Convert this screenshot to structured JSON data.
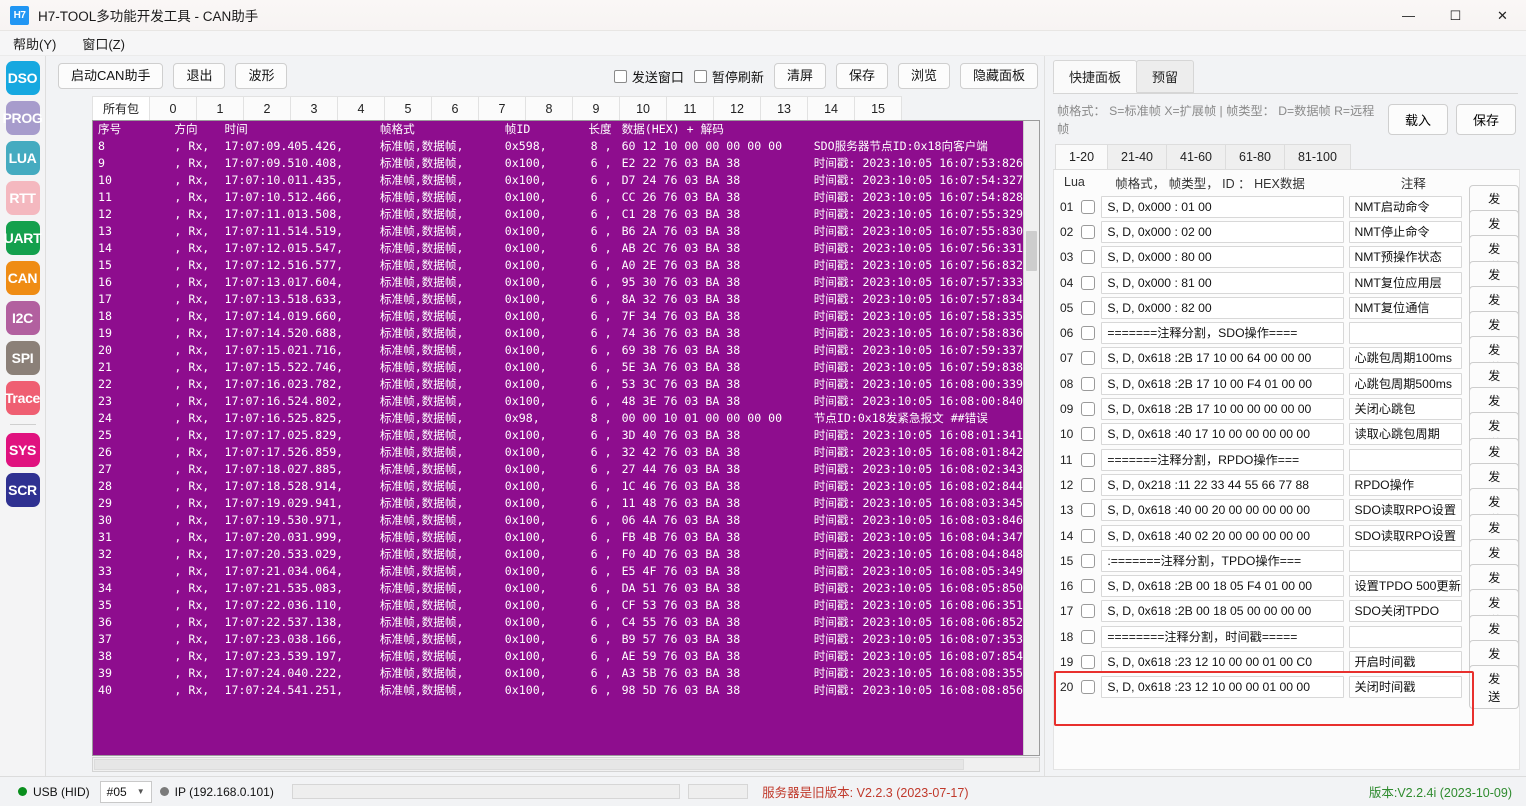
{
  "window": {
    "logo_text": "H7",
    "title": "H7-TOOL多功能开发工具 - CAN助手",
    "minimize": "—",
    "maximize": "☐",
    "close": "✕"
  },
  "menu": {
    "items": [
      {
        "label": "帮助(Y)"
      },
      {
        "label": "窗口(Z)"
      }
    ]
  },
  "rail": {
    "items": [
      {
        "label": "DSO",
        "color": "#16a8e0"
      },
      {
        "label": "PROG",
        "color": "#a79ccc"
      },
      {
        "label": "LUA",
        "color": "#45abc0"
      },
      {
        "label": "RTT",
        "color": "#f4b8bf"
      },
      {
        "label": "UART",
        "color": "#14a04d"
      },
      {
        "label": "CAN",
        "color": "#ef8c14"
      },
      {
        "label": "I2C",
        "color": "#b2609f"
      },
      {
        "label": "SPI",
        "color": "#8b8078"
      },
      {
        "label": "Trace",
        "color": "#ef5f72"
      },
      {
        "label": "SYS",
        "color": "#e0127f"
      },
      {
        "label": "SCR",
        "color": "#2f3191"
      }
    ],
    "separator_after_index": 8
  },
  "toolbar": {
    "start_button": "启动CAN助手",
    "exit_button": "退出",
    "wave_button": "波形",
    "send_window_checkbox": "发送窗口",
    "pause_refresh_checkbox": "暂停刷新",
    "clear_button": "清屏",
    "save_button": "保存",
    "browse_button": "浏览",
    "hide_panel_button": "隐藏面板"
  },
  "packet_tabs": {
    "active_index": 0,
    "items": [
      "所有包",
      "0",
      "1",
      "2",
      "3",
      "4",
      "5",
      "6",
      "7",
      "8",
      "9",
      "10",
      "11",
      "12",
      "13",
      "14",
      "15"
    ]
  },
  "log": {
    "headers": {
      "seq": "序号",
      "dir": "方向",
      "time": "时间",
      "format": "帧格式",
      "id": "帧ID",
      "length": "长度",
      "data": "数据(HEX) + 解码"
    },
    "rows": [
      {
        "seq": "8",
        "dir": ", Rx,",
        "time": "17:07:09.405.426,",
        "fmt": "标准帧,数据帧,",
        "id": "0x598,",
        "len": "8  ,",
        "data": "60 12 10 00 00 00 00 00",
        "dec": "SDO服务器节点ID:0x18向客户端"
      },
      {
        "seq": "9",
        "dir": ", Rx,",
        "time": "17:07:09.510.408,",
        "fmt": "标准帧,数据帧,",
        "id": "0x100,",
        "len": "6  ,",
        "data": "E2 22 76 03 BA 38",
        "dec": "时间戳: 2023:10:05 16:07:53:826"
      },
      {
        "seq": "10",
        "dir": ", Rx,",
        "time": "17:07:10.011.435,",
        "fmt": "标准帧,数据帧,",
        "id": "0x100,",
        "len": "6  ,",
        "data": "D7 24 76 03 BA 38",
        "dec": "时间戳: 2023:10:05 16:07:54:327"
      },
      {
        "seq": "11",
        "dir": ", Rx,",
        "time": "17:07:10.512.466,",
        "fmt": "标准帧,数据帧,",
        "id": "0x100,",
        "len": "6  ,",
        "data": "CC 26 76 03 BA 38",
        "dec": "时间戳: 2023:10:05 16:07:54:828"
      },
      {
        "seq": "12",
        "dir": ", Rx,",
        "time": "17:07:11.013.508,",
        "fmt": "标准帧,数据帧,",
        "id": "0x100,",
        "len": "6  ,",
        "data": "C1 28 76 03 BA 38",
        "dec": "时间戳: 2023:10:05 16:07:55:329"
      },
      {
        "seq": "13",
        "dir": ", Rx,",
        "time": "17:07:11.514.519,",
        "fmt": "标准帧,数据帧,",
        "id": "0x100,",
        "len": "6  ,",
        "data": "B6 2A 76 03 BA 38",
        "dec": "时间戳: 2023:10:05 16:07:55:830"
      },
      {
        "seq": "14",
        "dir": ", Rx,",
        "time": "17:07:12.015.547,",
        "fmt": "标准帧,数据帧,",
        "id": "0x100,",
        "len": "6  ,",
        "data": "AB 2C 76 03 BA 38",
        "dec": "时间戳: 2023:10:05 16:07:56:331"
      },
      {
        "seq": "15",
        "dir": ", Rx,",
        "time": "17:07:12.516.577,",
        "fmt": "标准帧,数据帧,",
        "id": "0x100,",
        "len": "6  ,",
        "data": "A0 2E 76 03 BA 38",
        "dec": "时间戳: 2023:10:05 16:07:56:832"
      },
      {
        "seq": "16",
        "dir": ", Rx,",
        "time": "17:07:13.017.604,",
        "fmt": "标准帧,数据帧,",
        "id": "0x100,",
        "len": "6  ,",
        "data": "95 30 76 03 BA 38",
        "dec": "时间戳: 2023:10:05 16:07:57:333"
      },
      {
        "seq": "17",
        "dir": ", Rx,",
        "time": "17:07:13.518.633,",
        "fmt": "标准帧,数据帧,",
        "id": "0x100,",
        "len": "6  ,",
        "data": "8A 32 76 03 BA 38",
        "dec": "时间戳: 2023:10:05 16:07:57:834"
      },
      {
        "seq": "18",
        "dir": ", Rx,",
        "time": "17:07:14.019.660,",
        "fmt": "标准帧,数据帧,",
        "id": "0x100,",
        "len": "6  ,",
        "data": "7F 34 76 03 BA 38",
        "dec": "时间戳: 2023:10:05 16:07:58:335"
      },
      {
        "seq": "19",
        "dir": ", Rx,",
        "time": "17:07:14.520.688,",
        "fmt": "标准帧,数据帧,",
        "id": "0x100,",
        "len": "6  ,",
        "data": "74 36 76 03 BA 38",
        "dec": "时间戳: 2023:10:05 16:07:58:836"
      },
      {
        "seq": "20",
        "dir": ", Rx,",
        "time": "17:07:15.021.716,",
        "fmt": "标准帧,数据帧,",
        "id": "0x100,",
        "len": "6  ,",
        "data": "69 38 76 03 BA 38",
        "dec": "时间戳: 2023:10:05 16:07:59:337"
      },
      {
        "seq": "21",
        "dir": ", Rx,",
        "time": "17:07:15.522.746,",
        "fmt": "标准帧,数据帧,",
        "id": "0x100,",
        "len": "6  ,",
        "data": "5E 3A 76 03 BA 38",
        "dec": "时间戳: 2023:10:05 16:07:59:838"
      },
      {
        "seq": "22",
        "dir": ", Rx,",
        "time": "17:07:16.023.782,",
        "fmt": "标准帧,数据帧,",
        "id": "0x100,",
        "len": "6  ,",
        "data": "53 3C 76 03 BA 38",
        "dec": "时间戳: 2023:10:05 16:08:00:339"
      },
      {
        "seq": "23",
        "dir": ", Rx,",
        "time": "17:07:16.524.802,",
        "fmt": "标准帧,数据帧,",
        "id": "0x100,",
        "len": "6  ,",
        "data": "48 3E 76 03 BA 38",
        "dec": "时间戳: 2023:10:05 16:08:00:840"
      },
      {
        "seq": "24",
        "dir": ", Rx,",
        "time": "17:07:16.525.825,",
        "fmt": "标准帧,数据帧,",
        "id": "0x98,",
        "len": "8  ,",
        "data": "00 00 10 01 00 00 00 00",
        "dec": "节点ID:0x18发紧急报文   ##错误"
      },
      {
        "seq": "25",
        "dir": ", Rx,",
        "time": "17:07:17.025.829,",
        "fmt": "标准帧,数据帧,",
        "id": "0x100,",
        "len": "6  ,",
        "data": "3D 40 76 03 BA 38",
        "dec": "时间戳: 2023:10:05 16:08:01:341"
      },
      {
        "seq": "26",
        "dir": ", Rx,",
        "time": "17:07:17.526.859,",
        "fmt": "标准帧,数据帧,",
        "id": "0x100,",
        "len": "6  ,",
        "data": "32 42 76 03 BA 38",
        "dec": "时间戳: 2023:10:05 16:08:01:842"
      },
      {
        "seq": "27",
        "dir": ", Rx,",
        "time": "17:07:18.027.885,",
        "fmt": "标准帧,数据帧,",
        "id": "0x100,",
        "len": "6  ,",
        "data": "27 44 76 03 BA 38",
        "dec": "时间戳: 2023:10:05 16:08:02:343"
      },
      {
        "seq": "28",
        "dir": ", Rx,",
        "time": "17:07:18.528.914,",
        "fmt": "标准帧,数据帧,",
        "id": "0x100,",
        "len": "6  ,",
        "data": "1C 46 76 03 BA 38",
        "dec": "时间戳: 2023:10:05 16:08:02:844"
      },
      {
        "seq": "29",
        "dir": ", Rx,",
        "time": "17:07:19.029.941,",
        "fmt": "标准帧,数据帧,",
        "id": "0x100,",
        "len": "6  ,",
        "data": "11 48 76 03 BA 38",
        "dec": "时间戳: 2023:10:05 16:08:03:345"
      },
      {
        "seq": "30",
        "dir": ", Rx,",
        "time": "17:07:19.530.971,",
        "fmt": "标准帧,数据帧,",
        "id": "0x100,",
        "len": "6  ,",
        "data": "06 4A 76 03 BA 38",
        "dec": "时间戳: 2023:10:05 16:08:03:846"
      },
      {
        "seq": "31",
        "dir": ", Rx,",
        "time": "17:07:20.031.999,",
        "fmt": "标准帧,数据帧,",
        "id": "0x100,",
        "len": "6  ,",
        "data": "FB 4B 76 03 BA 38",
        "dec": "时间戳: 2023:10:05 16:08:04:347"
      },
      {
        "seq": "32",
        "dir": ", Rx,",
        "time": "17:07:20.533.029,",
        "fmt": "标准帧,数据帧,",
        "id": "0x100,",
        "len": "6  ,",
        "data": "F0 4D 76 03 BA 38",
        "dec": "时间戳: 2023:10:05 16:08:04:848"
      },
      {
        "seq": "33",
        "dir": ", Rx,",
        "time": "17:07:21.034.064,",
        "fmt": "标准帧,数据帧,",
        "id": "0x100,",
        "len": "6  ,",
        "data": "E5 4F 76 03 BA 38",
        "dec": "时间戳: 2023:10:05 16:08:05:349"
      },
      {
        "seq": "34",
        "dir": ", Rx,",
        "time": "17:07:21.535.083,",
        "fmt": "标准帧,数据帧,",
        "id": "0x100,",
        "len": "6  ,",
        "data": "DA 51 76 03 BA 38",
        "dec": "时间戳: 2023:10:05 16:08:05:850"
      },
      {
        "seq": "35",
        "dir": ", Rx,",
        "time": "17:07:22.036.110,",
        "fmt": "标准帧,数据帧,",
        "id": "0x100,",
        "len": "6  ,",
        "data": "CF 53 76 03 BA 38",
        "dec": "时间戳: 2023:10:05 16:08:06:351"
      },
      {
        "seq": "36",
        "dir": ", Rx,",
        "time": "17:07:22.537.138,",
        "fmt": "标准帧,数据帧,",
        "id": "0x100,",
        "len": "6  ,",
        "data": "C4 55 76 03 BA 38",
        "dec": "时间戳: 2023:10:05 16:08:06:852"
      },
      {
        "seq": "37",
        "dir": ", Rx,",
        "time": "17:07:23.038.166,",
        "fmt": "标准帧,数据帧,",
        "id": "0x100,",
        "len": "6  ,",
        "data": "B9 57 76 03 BA 38",
        "dec": "时间戳: 2023:10:05 16:08:07:353"
      },
      {
        "seq": "38",
        "dir": ", Rx,",
        "time": "17:07:23.539.197,",
        "fmt": "标准帧,数据帧,",
        "id": "0x100,",
        "len": "6  ,",
        "data": "AE 59 76 03 BA 38",
        "dec": "时间戳: 2023:10:05 16:08:07:854"
      },
      {
        "seq": "39",
        "dir": ", Rx,",
        "time": "17:07:24.040.222,",
        "fmt": "标准帧,数据帧,",
        "id": "0x100,",
        "len": "6  ,",
        "data": "A3 5B 76 03 BA 38",
        "dec": "时间戳: 2023:10:05 16:08:08:355"
      },
      {
        "seq": "40",
        "dir": ", Rx,",
        "time": "17:07:24.541.251,",
        "fmt": "标准帧,数据帧,",
        "id": "0x100,",
        "len": "6  ,",
        "data": "98 5D 76 03 BA 38",
        "dec": "时间戳: 2023:10:05 16:08:08:856"
      }
    ]
  },
  "right_panel": {
    "tabs": [
      {
        "label": "快捷面板",
        "active": true
      },
      {
        "label": "预留",
        "active": false
      }
    ],
    "format_hint": "帧格式： S=标准帧 X=扩展帧 | 帧类型： D=数据帧 R=远程帧",
    "load_button": "载入",
    "save_button": "保存",
    "range_tabs": {
      "active_index": 0,
      "items": [
        "1-20",
        "21-40",
        "41-60",
        "61-80",
        "81-100"
      ]
    },
    "list_headers": {
      "lua": "Lua",
      "frame": "帧格式， 帧类型， ID ： HEX数据",
      "note": "注释"
    },
    "send_label": "发送",
    "highlight_color": "#e8302d",
    "rows": [
      {
        "no": "01",
        "frame": "S, D, 0x000 : 01 00",
        "note": "NMT启动命令",
        "highlight": false
      },
      {
        "no": "02",
        "frame": "S, D, 0x000 : 02 00",
        "note": "NMT停止命令",
        "highlight": false
      },
      {
        "no": "03",
        "frame": "S, D, 0x000 : 80 00",
        "note": "NMT预操作状态",
        "highlight": false
      },
      {
        "no": "04",
        "frame": "S, D, 0x000 : 81 00",
        "note": "NMT复位应用层",
        "highlight": false
      },
      {
        "no": "05",
        "frame": "S, D, 0x000 : 82 00",
        "note": "NMT复位通信",
        "highlight": false
      },
      {
        "no": "06",
        "frame": "=======注释分割，SDO操作====",
        "note": "",
        "highlight": false
      },
      {
        "no": "07",
        "frame": "S, D, 0x618 :2B 17 10 00 64 00 00 00",
        "note": "心跳包周期100ms",
        "highlight": false
      },
      {
        "no": "08",
        "frame": "S, D, 0x618 :2B 17 10 00 F4 01 00 00",
        "note": "心跳包周期500ms",
        "highlight": false
      },
      {
        "no": "09",
        "frame": "S, D, 0x618 :2B 17 10 00 00 00 00 00",
        "note": "关闭心跳包",
        "highlight": false
      },
      {
        "no": "10",
        "frame": "S, D, 0x618 :40 17 10 00 00 00 00 00",
        "note": "读取心跳包周期",
        "highlight": false
      },
      {
        "no": "11",
        "frame": "=======注释分割，RPDO操作===",
        "note": "",
        "highlight": false
      },
      {
        "no": "12",
        "frame": "S, D, 0x218 :11 22 33 44 55 66 77 88",
        "note": "RPDO操作",
        "highlight": false
      },
      {
        "no": "13",
        "frame": "S, D, 0x618 :40 00 20 00 00 00 00 00",
        "note": "SDO读取RPO设置",
        "highlight": false
      },
      {
        "no": "14",
        "frame": "S, D, 0x618 :40 02 20 00 00 00 00 00",
        "note": "SDO读取RPO设置",
        "highlight": false
      },
      {
        "no": "15",
        "frame": ":=======注释分割，TPDO操作===",
        "note": "",
        "highlight": false
      },
      {
        "no": "16",
        "frame": "S, D, 0x618 :2B 00 18 05 F4 01 00 00",
        "note": "设置TPDO 500更新",
        "highlight": false
      },
      {
        "no": "17",
        "frame": "S, D, 0x618 :2B 00 18 05 00 00 00 00",
        "note": "SDO关闭TPDO",
        "highlight": false
      },
      {
        "no": "18",
        "frame": "========注释分割，时间戳=====",
        "note": "",
        "highlight": false
      },
      {
        "no": "19",
        "frame": "S, D, 0x618 :23 12 10 00 00 01 00 C0",
        "note": "开启时间戳",
        "highlight": true
      },
      {
        "no": "20",
        "frame": "S, D, 0x618 :23 12 10 00 00 01 00 00",
        "note": "关闭时间戳",
        "highlight": true
      }
    ]
  },
  "statusbar": {
    "usb_label": "USB (HID)",
    "usb_dot_color": "#0a8f1d",
    "device_select": "#05",
    "ip_label": "IP (192.168.0.101)",
    "ip_dot_color": "#7a7a7a",
    "server_message": "服务器是旧版本: V2.2.3 (2023-07-17)",
    "version": "版本:V2.2.4i (2023-10-09)",
    "server_message_color": "#c0392b",
    "version_color": "#2e8b2e"
  }
}
